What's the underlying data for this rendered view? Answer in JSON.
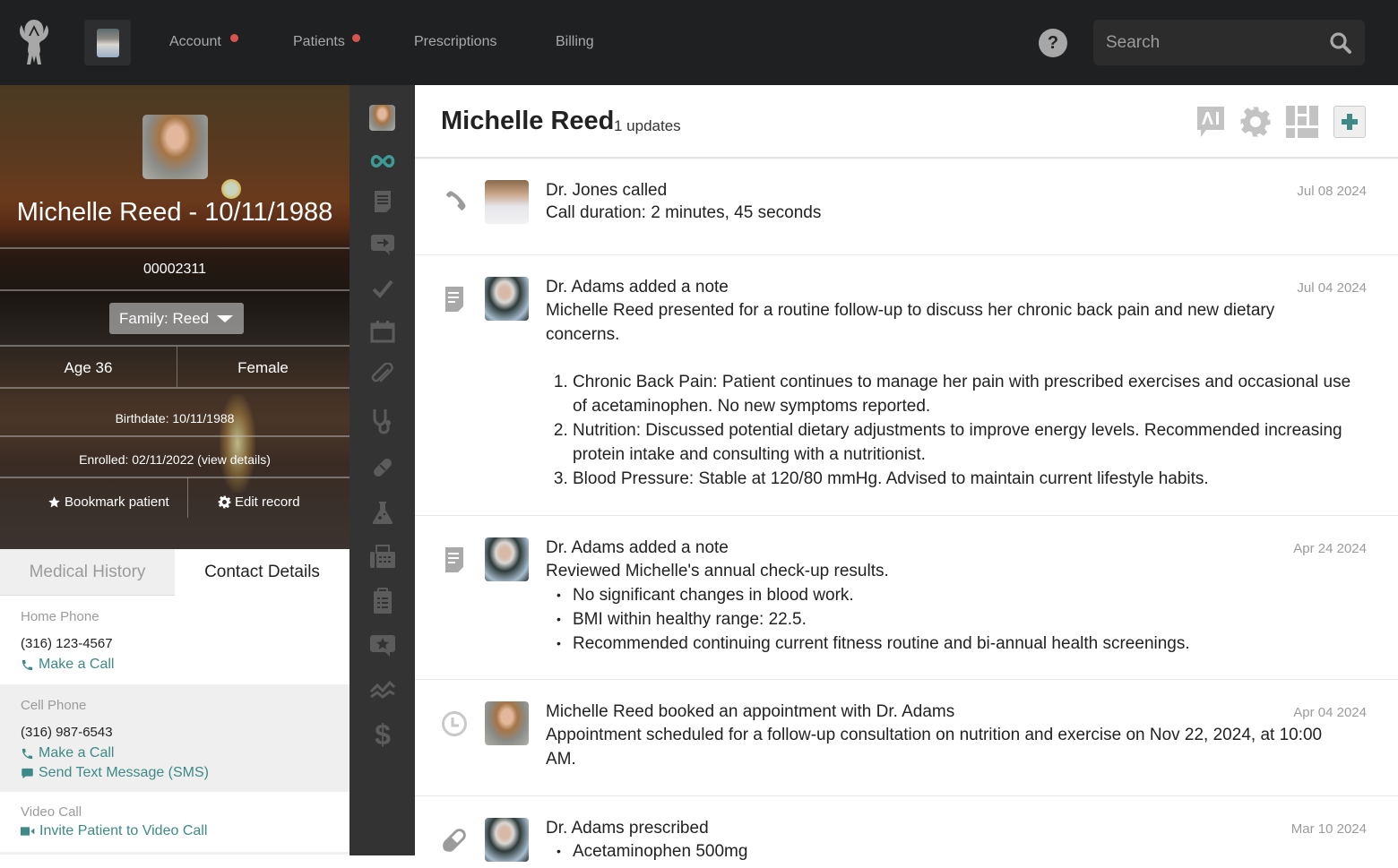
{
  "topbar": {
    "nav": [
      {
        "label": "Account",
        "has_notification": true
      },
      {
        "label": "Patients",
        "has_notification": true
      },
      {
        "label": "Prescriptions",
        "has_notification": false
      },
      {
        "label": "Billing",
        "has_notification": false
      }
    ],
    "help_label": "?",
    "search_placeholder": "Search",
    "notification_color": "#d9534f"
  },
  "patient": {
    "name_dob": "Michelle Reed - 10/11/1988",
    "id": "00002311",
    "family_label": "Family: Reed",
    "age": "Age 36",
    "gender": "Female",
    "birthdate": "Birthdate: 10/11/1988",
    "enrolled": "Enrolled: 02/11/2022 (view details)",
    "bookmark_label": "Bookmark patient",
    "edit_label": "Edit record"
  },
  "tabs": {
    "medical_history": "Medical History",
    "contact_details": "Contact Details",
    "active": "Contact Details"
  },
  "contact": {
    "home": {
      "label": "Home Phone",
      "value": "(316) 123-4567",
      "call": "Make a Call"
    },
    "cell": {
      "label": "Cell Phone",
      "value": "(316) 987-6543",
      "call": "Make a Call",
      "sms": "Send Text Message (SMS)"
    },
    "video": {
      "label": "Video Call",
      "invite": "Invite Patient to Video Call"
    },
    "link_color": "#3d8a86"
  },
  "iconbar": {
    "items": [
      "patient-avatar",
      "timeline",
      "notes",
      "messages",
      "tasks",
      "calendar",
      "attachments",
      "stethoscope",
      "prescriptions",
      "lab",
      "fax",
      "forms",
      "reviews",
      "trends",
      "billing"
    ],
    "active": "timeline",
    "accent": "#3d9a95"
  },
  "main": {
    "title": "Michelle Reed",
    "updates": "1 updates",
    "header_icons": [
      "ai-chat",
      "settings",
      "layout",
      "add"
    ],
    "feed": [
      {
        "type": "call",
        "title": "Dr. Jones called",
        "date": "Jul 08 2024",
        "body": "Call duration: 2 minutes, 45 seconds"
      },
      {
        "type": "note",
        "title": "Dr. Adams added a note",
        "date": "Jul 04 2024",
        "body": "Michelle Reed presented for a routine follow-up to discuss her chronic back pain and new dietary concerns.",
        "list": [
          "Chronic Back Pain: Patient continues to manage her pain with prescribed exercises and occasional use of acetaminophen. No new symptoms reported.",
          "Nutrition: Discussed potential dietary adjustments to improve energy levels. Recommended increasing protein intake and consulting with a nutritionist.",
          "Blood Pressure: Stable at 120/80 mmHg. Advised to maintain current lifestyle habits."
        ]
      },
      {
        "type": "note",
        "title": "Dr. Adams added a note",
        "date": "Apr 24 2024",
        "body": "Reviewed Michelle's annual check-up results.",
        "list": [
          "No significant changes in blood work.",
          "BMI within healthy range: 22.5.",
          "Recommended continuing current fitness routine and bi-annual health screenings."
        ]
      },
      {
        "type": "appointment",
        "title": "Michelle Reed booked an appointment with Dr. Adams",
        "date": "Apr 04 2024",
        "body": "Appointment scheduled for a follow-up consultation on nutrition and exercise on Nov 22, 2024, at 10:00 AM."
      },
      {
        "type": "prescription",
        "title": "Dr. Adams prescribed",
        "date": "Mar 10 2024",
        "list": [
          "Acetaminophen 500mg"
        ]
      }
    ]
  }
}
